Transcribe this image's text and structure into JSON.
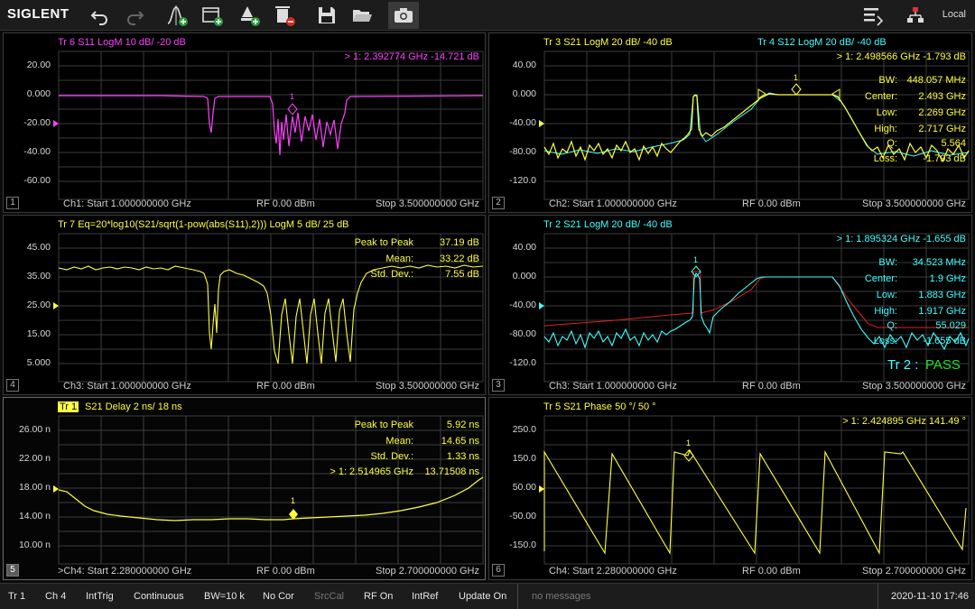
{
  "toolbar": {
    "logo": "SIGLENT",
    "local": "Local",
    "icons": [
      "undo-icon",
      "redo-icon",
      "add-marker-icon",
      "add-window-icon",
      "add-trace-icon",
      "delete-trace-icon",
      "save-icon",
      "open-folder-icon",
      "camera-icon",
      "layout-menu-icon",
      "network-icon"
    ]
  },
  "panels": {
    "p1": {
      "number": "1",
      "title": "Tr 6   S11  LogM  10 dB/ -20 dB",
      "marker": "> 1:  2.392774 GHz       -14.721 dB",
      "yticks": [
        "20.00",
        "0.000",
        "-20.00",
        "-40.00",
        "-60.00"
      ],
      "footer_start": "Ch1: Start  1.000000000 GHz",
      "footer_rf": "RF  0.00 dBm",
      "footer_stop": "Stop  3.500000000 GHz"
    },
    "p2": {
      "number": "2",
      "title": "Tr 3   S21  LogM  20 dB/ -40 dB",
      "title2": "Tr 4   S12  LogM  20 dB/ -40 dB",
      "marker": "> 1:  2.498566 GHz         -1.793 dB",
      "stats": [
        {
          "k": "BW:",
          "v": "448.057 MHz"
        },
        {
          "k": "Center:",
          "v": "2.493 GHz"
        },
        {
          "k": "Low:",
          "v": "2.269 GHz"
        },
        {
          "k": "High:",
          "v": "2.717 GHz"
        },
        {
          "k": "Q:",
          "v": "5.564"
        },
        {
          "k": "Loss:",
          "v": "-1.793 dB"
        }
      ],
      "yticks": [
        "40.00",
        "0.000",
        "-40.00",
        "-80.00",
        "-120.0"
      ],
      "footer_start": "Ch2: Start  1.000000000 GHz",
      "footer_rf": "RF  0.00 dBm",
      "footer_stop": "Stop  3.500000000 GHz"
    },
    "p3": {
      "number": "3",
      "title": "Tr 2   S21  LogM  20 dB/ -40 dB",
      "marker": "> 1:  1.895324 GHz          -1.655 dB",
      "stats": [
        {
          "k": "BW:",
          "v": "34.523 MHz"
        },
        {
          "k": "Center:",
          "v": "1.9 GHz"
        },
        {
          "k": "Low:",
          "v": "1.883 GHz"
        },
        {
          "k": "High:",
          "v": "1.917 GHz"
        },
        {
          "k": "Q:",
          "v": "55.029"
        },
        {
          "k": "Loss:",
          "v": "-1.655 dB"
        }
      ],
      "pass_label": "Tr 2 :",
      "pass_value": "PASS",
      "yticks": [
        "40.00",
        "0.000",
        "-40.00",
        "-80.00",
        "-120.0"
      ],
      "footer_start": "Ch3: Start  1.000000000 GHz",
      "footer_rf": "RF  0.00 dBm",
      "footer_stop": "Stop  3.500000000 GHz"
    },
    "p4": {
      "number": "4",
      "title": "Tr 7   Eq=20*log10(S21/sqrt(1-pow(abs(S11),2)))  LogM  5 dB/  25 dB",
      "stats": [
        {
          "k": "Peak to Peak",
          "v": "37.19 dB"
        },
        {
          "k": "Mean:",
          "v": "33.22 dB"
        },
        {
          "k": "Std. Dev.:",
          "v": "7.55 dB"
        }
      ],
      "yticks": [
        "45.00",
        "35.00",
        "25.00",
        "15.00",
        "5.000"
      ],
      "footer_start": "Ch3: Start  1.000000000 GHz",
      "footer_rf": "RF  0.00 dBm",
      "footer_stop": "Stop  3.500000000 GHz"
    },
    "p5": {
      "number": "5",
      "tag": "Tr 1",
      "title": "S21  Delay  2 ns/  18 ns",
      "stats": [
        {
          "k": "Peak to Peak",
          "v": "5.92 ns"
        },
        {
          "k": "Mean:",
          "v": "14.65 ns"
        },
        {
          "k": "Std. Dev.:",
          "v": "1.33 ns"
        },
        {
          "k": "> 1:  2.514965 GHz",
          "v": "13.71508 ns"
        }
      ],
      "yticks": [
        "26.00 n",
        "22.00 n",
        "18.00 n",
        "14.00 n",
        "10.00 n"
      ],
      "footer_start": ">Ch4: Start  2.280000000 GHz",
      "footer_rf": "RF  0.00 dBm",
      "footer_stop": "Stop  2.700000000 GHz"
    },
    "p6": {
      "number": "6",
      "title": "Tr 5   S21  Phase  50 °/  50 °",
      "marker": "> 1:  2.424895 GHz          141.49 °",
      "yticks": [
        "250.0",
        "150.0",
        "50.00",
        "-50.00",
        "-150.0"
      ],
      "footer_start": "Ch4: Start  2.280000000 GHz",
      "footer_rf": "RF  0.00 dBm",
      "footer_stop": "Stop  2.700000000 GHz"
    }
  },
  "marker_label": "1",
  "status": {
    "items": [
      "Tr 1",
      "Ch 4",
      "IntTrig",
      "Continuous",
      "BW=10 k",
      "No Cor",
      "SrcCal",
      "RF On",
      "IntRef",
      "Update On"
    ],
    "message": "no messages",
    "datetime": "2020-11-10 17:46"
  },
  "colors": {
    "s11": "#ff40ff",
    "s21": "#ffff40",
    "s12": "#40ffff",
    "limit": "#e02020",
    "pass": "#20e020"
  }
}
